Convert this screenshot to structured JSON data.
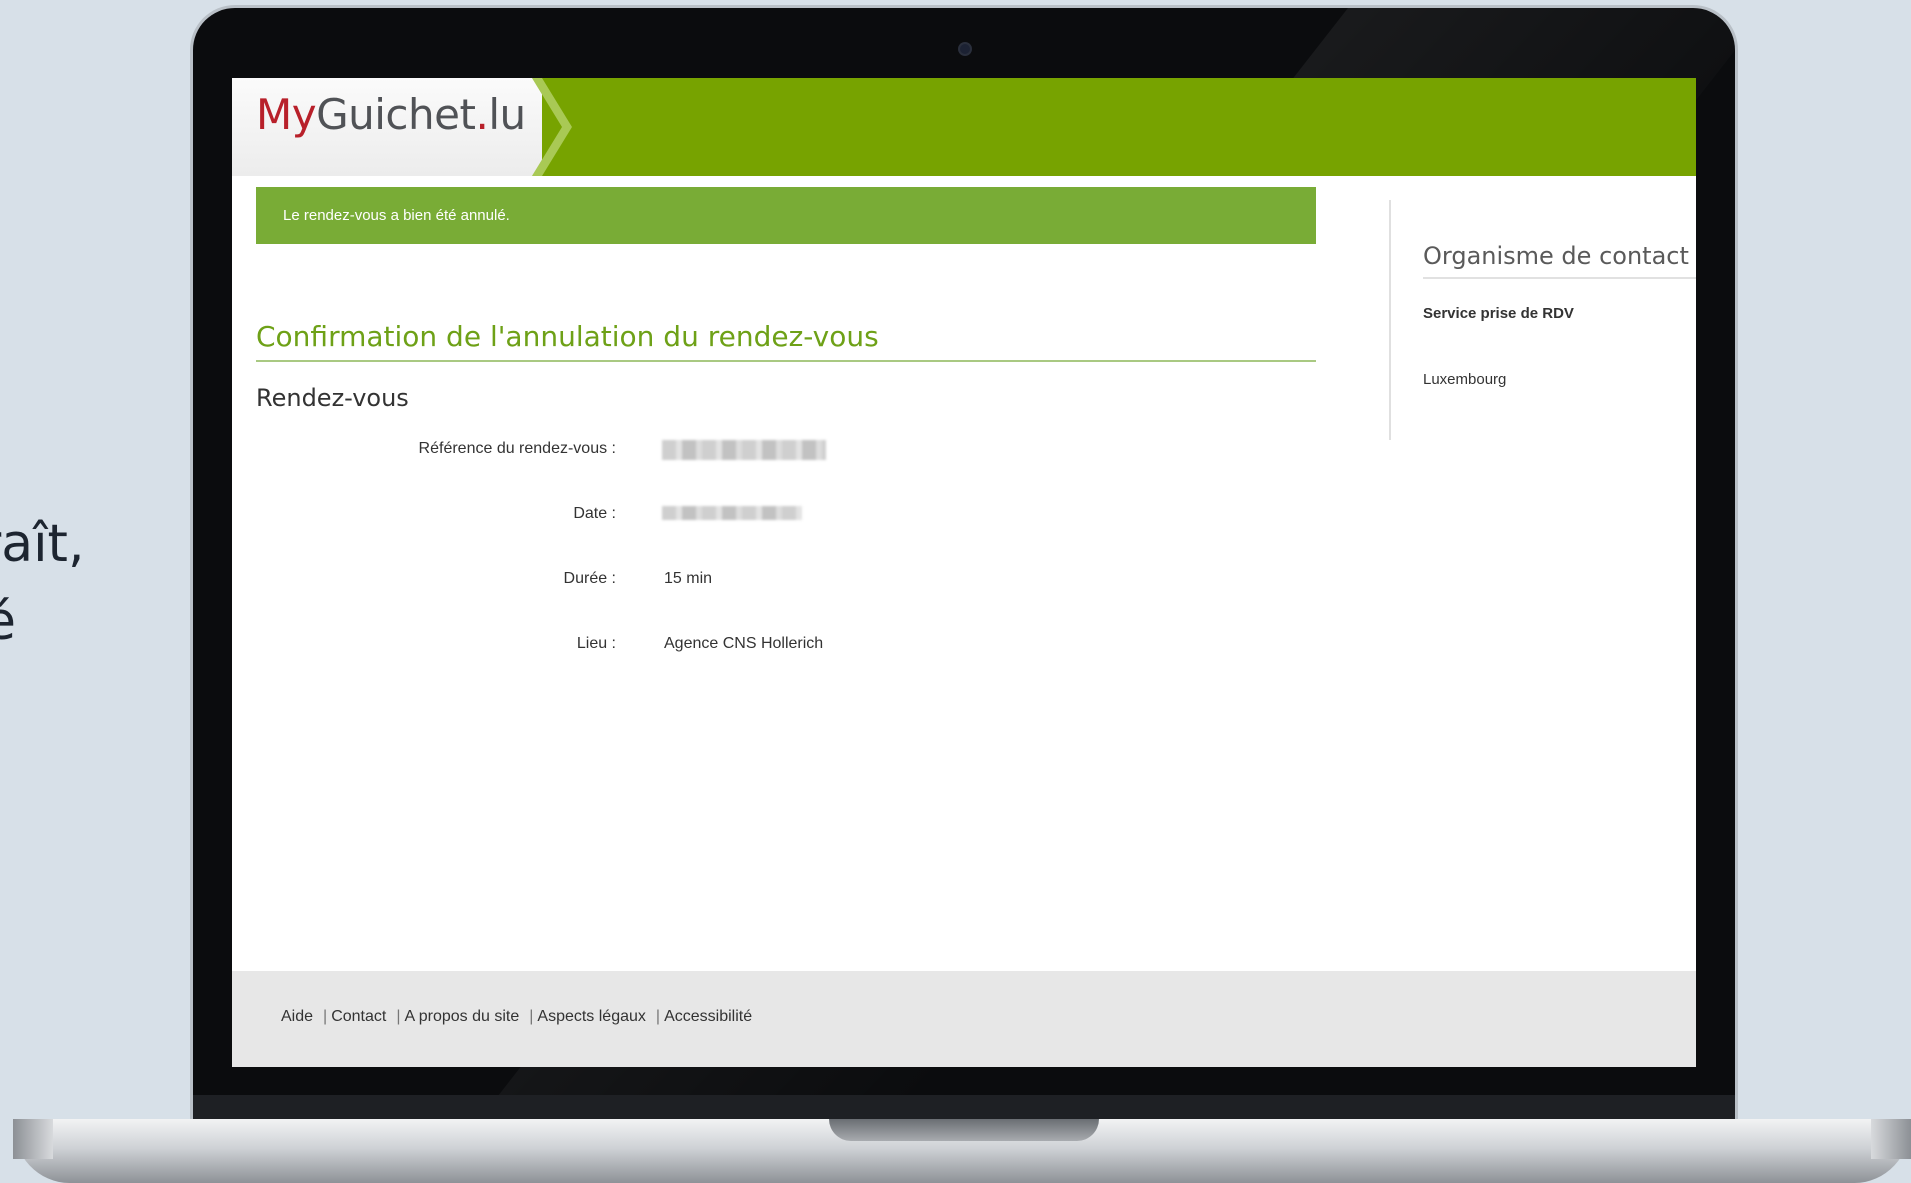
{
  "side_text": {
    "line1": "araît,",
    "line2": "é"
  },
  "header": {
    "logo_part1": "My",
    "logo_part2": "Guichet",
    "logo_dot": ".",
    "logo_part3": "lu"
  },
  "banner": {
    "message": "Le rendez-vous a bien été annulé."
  },
  "main": {
    "title": "Confirmation de l'annulation du rendez-vous",
    "section_title": "Rendez-vous",
    "fields": [
      {
        "label": "Référence du rendez-vous :",
        "value": ""
      },
      {
        "label": "Date :",
        "value": ""
      },
      {
        "label": "Durée :",
        "value": "15 min"
      },
      {
        "label": "Lieu :",
        "value": "Agence CNS Hollerich"
      }
    ]
  },
  "sidebar": {
    "title": "Organisme de contact",
    "organisation": "Service prise de RDV",
    "city": "Luxembourg"
  },
  "footer": {
    "links": [
      "Aide",
      "Contact",
      "A propos du site",
      "Aspects légaux",
      "Accessibilité"
    ],
    "separator": "|"
  },
  "colors": {
    "brand_green": "#77a300",
    "banner_green": "#79ac36",
    "title_green": "#6ea117",
    "logo_red": "#b8202a"
  }
}
